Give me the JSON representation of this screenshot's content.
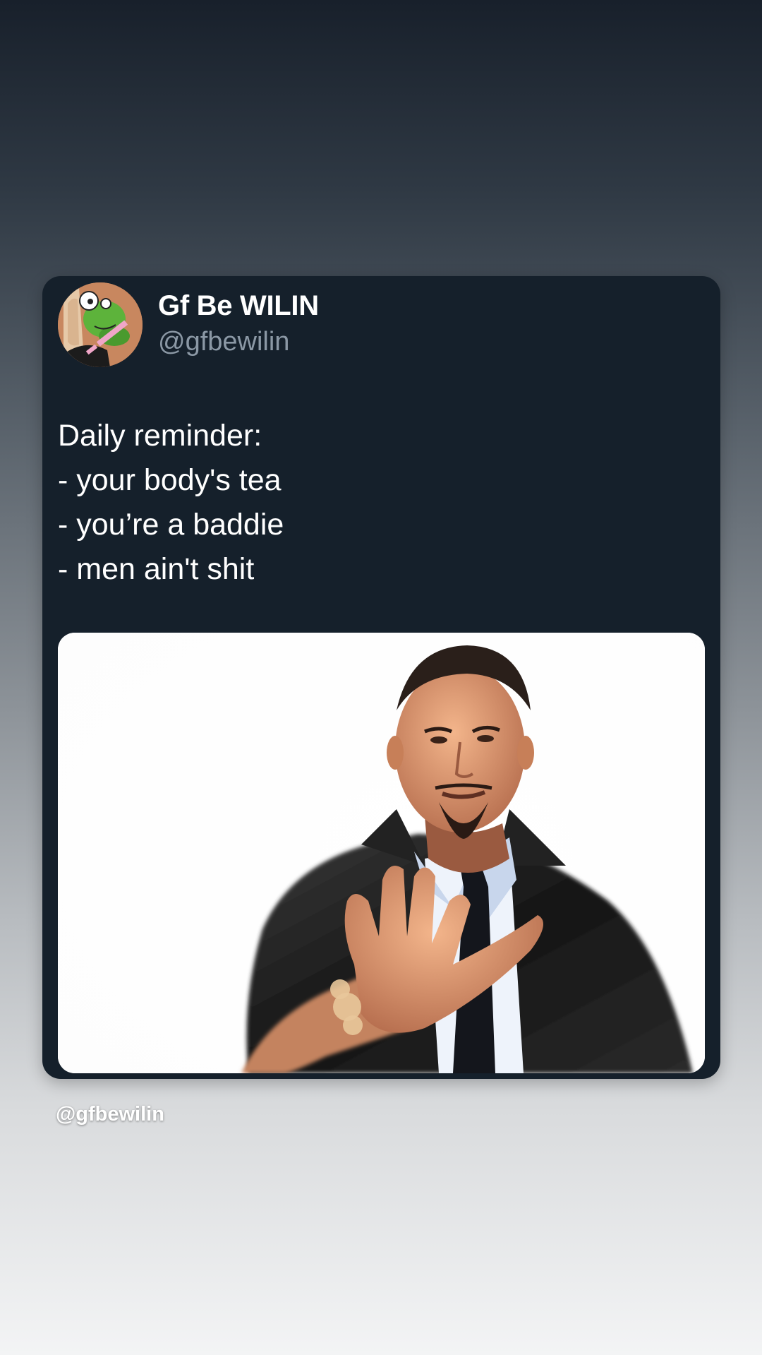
{
  "tweet": {
    "display_name": "Gf Be WILIN",
    "handle": "@gfbewilin",
    "text_lines": [
      "Daily reminder:",
      "- your body's tea",
      "- you’re a baddie",
      "- men ain't shit"
    ],
    "avatar_icon": "kermit-avatar-icon",
    "media": "photo of a man in a leather jacket and tie holding out his palm against a white background"
  },
  "watermark": "@gfbewilin",
  "colors": {
    "card_background": "#15202b",
    "display_name": "#ffffff",
    "handle": "#8b98a5",
    "text": "#ffffff"
  }
}
